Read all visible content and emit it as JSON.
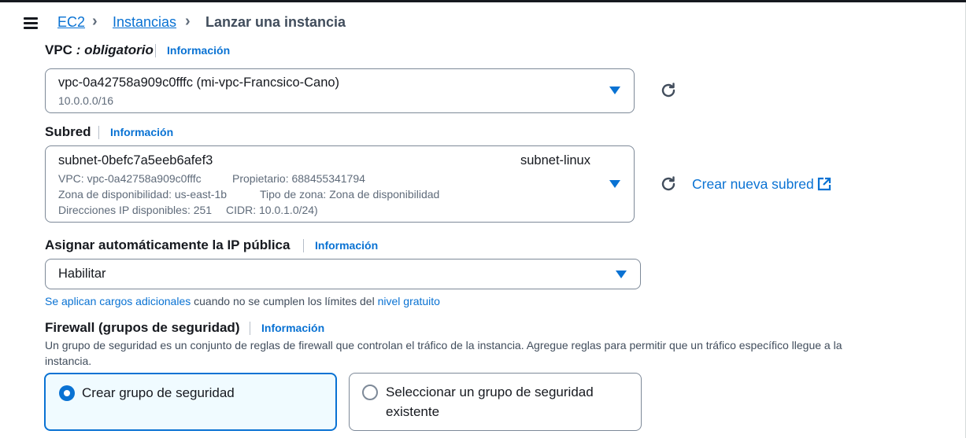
{
  "breadcrumb": {
    "items": [
      "EC2",
      "Instancias"
    ],
    "current": "Lanzar una instancia"
  },
  "info_label": "Información",
  "vpc": {
    "label": "VPC",
    "required": ": obligatorio",
    "selected": "vpc-0a42758a909c0fffc (mi-vpc-Francsico-Cano)",
    "cidr": "10.0.0.0/16"
  },
  "subnet": {
    "label": "Subred",
    "selected": "subnet-0befc7a5eeb6afef3",
    "name_tag": "subnet-linux",
    "vpc_line": "VPC: vpc-0a42758a909c0fffc",
    "owner": "Propietario: 688455341794",
    "az": "Zona de disponibilidad: us-east-1b",
    "az_type": "Tipo de zona: Zona de disponibilidad",
    "ips": "Direcciones IP disponibles: 251",
    "cidr": "CIDR: 10.0.1.0/24)",
    "create_link": "Crear nueva subred"
  },
  "public_ip": {
    "label": "Asignar automáticamente la IP pública",
    "selected": "Habilitar",
    "note_link1": "Se aplican cargos adicionales",
    "note_mid": "cuando no se cumplen los límites del",
    "note_link2": "nivel gratuito"
  },
  "firewall": {
    "label": "Firewall (grupos de seguridad)",
    "description_line1": "Un grupo de seguridad es un conjunto de reglas de firewall que controlan el tráfico de la instancia. Agregue reglas para permitir que un tráfico específico llegue a la",
    "description_line2": "instancia.",
    "option_create": "Crear grupo de seguridad",
    "option_select_line1": "Seleccionar un grupo de seguridad",
    "option_select_line2": "existente",
    "selected_option": "create"
  },
  "colors": {
    "link": "#0972d3",
    "text": "#16191f",
    "muted": "#5f6b7a",
    "border": "#7d8998",
    "selected_bg": "#f0fbff"
  },
  "icons": [
    "menu-icon",
    "chevron-right-icon",
    "refresh-icon",
    "caret-down-icon",
    "external-link-icon",
    "radio-icon"
  ]
}
